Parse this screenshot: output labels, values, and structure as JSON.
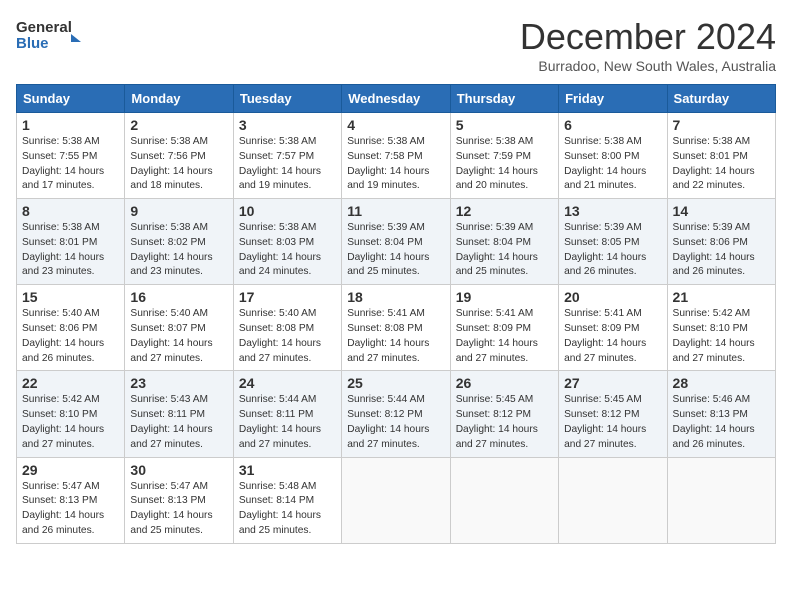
{
  "logo": {
    "line1": "General",
    "line2": "Blue"
  },
  "title": "December 2024",
  "subtitle": "Burradoo, New South Wales, Australia",
  "days_of_week": [
    "Sunday",
    "Monday",
    "Tuesday",
    "Wednesday",
    "Thursday",
    "Friday",
    "Saturday"
  ],
  "weeks": [
    [
      {
        "day": "1",
        "sunrise": "Sunrise: 5:38 AM",
        "sunset": "Sunset: 7:55 PM",
        "daylight": "Daylight: 14 hours and 17 minutes."
      },
      {
        "day": "2",
        "sunrise": "Sunrise: 5:38 AM",
        "sunset": "Sunset: 7:56 PM",
        "daylight": "Daylight: 14 hours and 18 minutes."
      },
      {
        "day": "3",
        "sunrise": "Sunrise: 5:38 AM",
        "sunset": "Sunset: 7:57 PM",
        "daylight": "Daylight: 14 hours and 19 minutes."
      },
      {
        "day": "4",
        "sunrise": "Sunrise: 5:38 AM",
        "sunset": "Sunset: 7:58 PM",
        "daylight": "Daylight: 14 hours and 19 minutes."
      },
      {
        "day": "5",
        "sunrise": "Sunrise: 5:38 AM",
        "sunset": "Sunset: 7:59 PM",
        "daylight": "Daylight: 14 hours and 20 minutes."
      },
      {
        "day": "6",
        "sunrise": "Sunrise: 5:38 AM",
        "sunset": "Sunset: 8:00 PM",
        "daylight": "Daylight: 14 hours and 21 minutes."
      },
      {
        "day": "7",
        "sunrise": "Sunrise: 5:38 AM",
        "sunset": "Sunset: 8:01 PM",
        "daylight": "Daylight: 14 hours and 22 minutes."
      }
    ],
    [
      {
        "day": "8",
        "sunrise": "Sunrise: 5:38 AM",
        "sunset": "Sunset: 8:01 PM",
        "daylight": "Daylight: 14 hours and 23 minutes."
      },
      {
        "day": "9",
        "sunrise": "Sunrise: 5:38 AM",
        "sunset": "Sunset: 8:02 PM",
        "daylight": "Daylight: 14 hours and 23 minutes."
      },
      {
        "day": "10",
        "sunrise": "Sunrise: 5:38 AM",
        "sunset": "Sunset: 8:03 PM",
        "daylight": "Daylight: 14 hours and 24 minutes."
      },
      {
        "day": "11",
        "sunrise": "Sunrise: 5:39 AM",
        "sunset": "Sunset: 8:04 PM",
        "daylight": "Daylight: 14 hours and 25 minutes."
      },
      {
        "day": "12",
        "sunrise": "Sunrise: 5:39 AM",
        "sunset": "Sunset: 8:04 PM",
        "daylight": "Daylight: 14 hours and 25 minutes."
      },
      {
        "day": "13",
        "sunrise": "Sunrise: 5:39 AM",
        "sunset": "Sunset: 8:05 PM",
        "daylight": "Daylight: 14 hours and 26 minutes."
      },
      {
        "day": "14",
        "sunrise": "Sunrise: 5:39 AM",
        "sunset": "Sunset: 8:06 PM",
        "daylight": "Daylight: 14 hours and 26 minutes."
      }
    ],
    [
      {
        "day": "15",
        "sunrise": "Sunrise: 5:40 AM",
        "sunset": "Sunset: 8:06 PM",
        "daylight": "Daylight: 14 hours and 26 minutes."
      },
      {
        "day": "16",
        "sunrise": "Sunrise: 5:40 AM",
        "sunset": "Sunset: 8:07 PM",
        "daylight": "Daylight: 14 hours and 27 minutes."
      },
      {
        "day": "17",
        "sunrise": "Sunrise: 5:40 AM",
        "sunset": "Sunset: 8:08 PM",
        "daylight": "Daylight: 14 hours and 27 minutes."
      },
      {
        "day": "18",
        "sunrise": "Sunrise: 5:41 AM",
        "sunset": "Sunset: 8:08 PM",
        "daylight": "Daylight: 14 hours and 27 minutes."
      },
      {
        "day": "19",
        "sunrise": "Sunrise: 5:41 AM",
        "sunset": "Sunset: 8:09 PM",
        "daylight": "Daylight: 14 hours and 27 minutes."
      },
      {
        "day": "20",
        "sunrise": "Sunrise: 5:41 AM",
        "sunset": "Sunset: 8:09 PM",
        "daylight": "Daylight: 14 hours and 27 minutes."
      },
      {
        "day": "21",
        "sunrise": "Sunrise: 5:42 AM",
        "sunset": "Sunset: 8:10 PM",
        "daylight": "Daylight: 14 hours and 27 minutes."
      }
    ],
    [
      {
        "day": "22",
        "sunrise": "Sunrise: 5:42 AM",
        "sunset": "Sunset: 8:10 PM",
        "daylight": "Daylight: 14 hours and 27 minutes."
      },
      {
        "day": "23",
        "sunrise": "Sunrise: 5:43 AM",
        "sunset": "Sunset: 8:11 PM",
        "daylight": "Daylight: 14 hours and 27 minutes."
      },
      {
        "day": "24",
        "sunrise": "Sunrise: 5:44 AM",
        "sunset": "Sunset: 8:11 PM",
        "daylight": "Daylight: 14 hours and 27 minutes."
      },
      {
        "day": "25",
        "sunrise": "Sunrise: 5:44 AM",
        "sunset": "Sunset: 8:12 PM",
        "daylight": "Daylight: 14 hours and 27 minutes."
      },
      {
        "day": "26",
        "sunrise": "Sunrise: 5:45 AM",
        "sunset": "Sunset: 8:12 PM",
        "daylight": "Daylight: 14 hours and 27 minutes."
      },
      {
        "day": "27",
        "sunrise": "Sunrise: 5:45 AM",
        "sunset": "Sunset: 8:12 PM",
        "daylight": "Daylight: 14 hours and 27 minutes."
      },
      {
        "day": "28",
        "sunrise": "Sunrise: 5:46 AM",
        "sunset": "Sunset: 8:13 PM",
        "daylight": "Daylight: 14 hours and 26 minutes."
      }
    ],
    [
      {
        "day": "29",
        "sunrise": "Sunrise: 5:47 AM",
        "sunset": "Sunset: 8:13 PM",
        "daylight": "Daylight: 14 hours and 26 minutes."
      },
      {
        "day": "30",
        "sunrise": "Sunrise: 5:47 AM",
        "sunset": "Sunset: 8:13 PM",
        "daylight": "Daylight: 14 hours and 25 minutes."
      },
      {
        "day": "31",
        "sunrise": "Sunrise: 5:48 AM",
        "sunset": "Sunset: 8:14 PM",
        "daylight": "Daylight: 14 hours and 25 minutes."
      },
      null,
      null,
      null,
      null
    ]
  ]
}
